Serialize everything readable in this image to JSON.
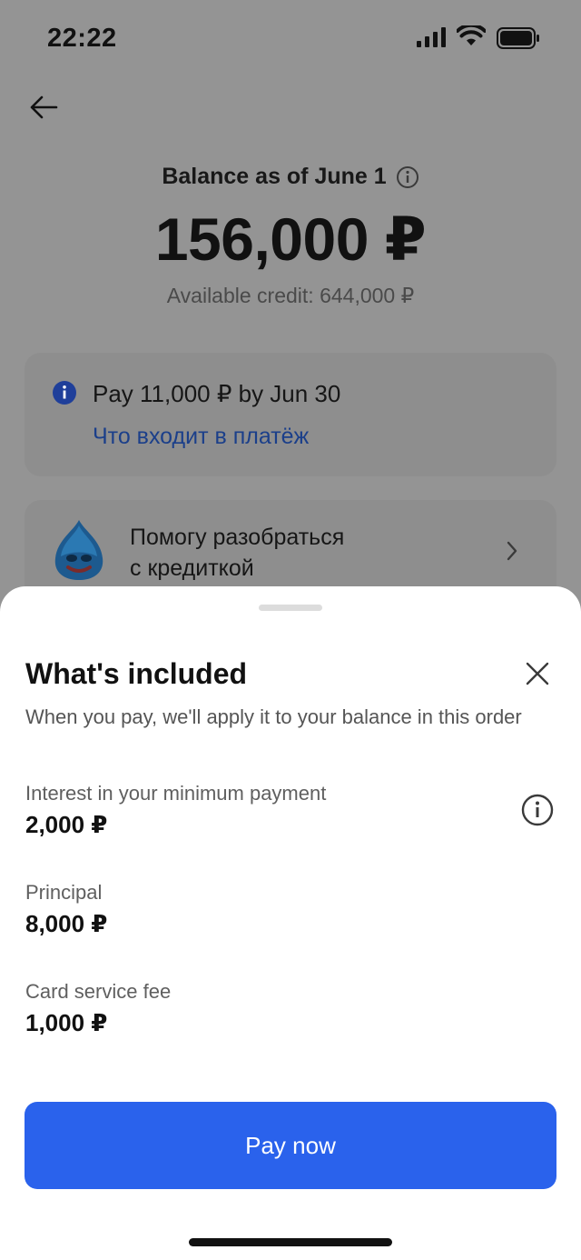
{
  "status_bar": {
    "time": "22:22"
  },
  "header": {
    "back_icon": "arrow-left-icon"
  },
  "balance": {
    "label": "Balance as of June 1",
    "amount": "156,000 ₽",
    "available_credit": "Available credit: 644,000 ₽"
  },
  "payment_card": {
    "text": "Pay 11,000 ₽ by Jun 30",
    "link": "Что входит в платёж"
  },
  "helper_card": {
    "line1": "Помогу разобраться",
    "line2": "с кредиткой"
  },
  "sheet": {
    "title": "What's included",
    "subtitle": "When you pay, we'll apply it to your balance in this order",
    "items": [
      {
        "label": "Interest in your minimum payment",
        "value": "2,000 ₽"
      },
      {
        "label": "Principal",
        "value": "8,000 ₽"
      },
      {
        "label": "Card service fee",
        "value": "1,000 ₽"
      }
    ],
    "button_label": "Pay now"
  },
  "colors": {
    "accent": "#2a62ec",
    "link": "#1b3f8a",
    "info_badge": "#1f3f9a",
    "overlay": "#949494"
  }
}
